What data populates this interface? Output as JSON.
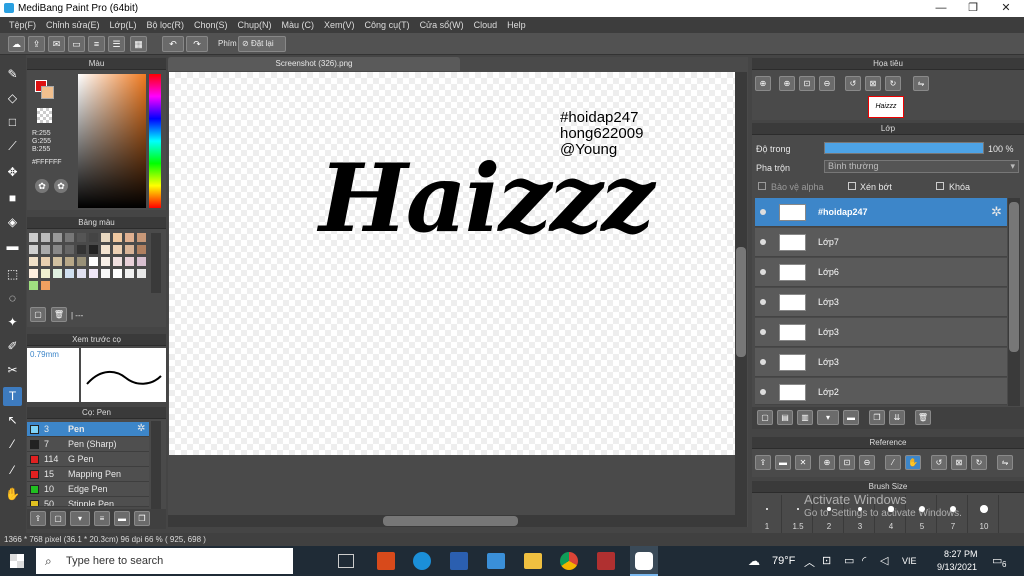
{
  "window": {
    "title": "MediBang Paint Pro (64bit)",
    "minimize": "—",
    "maximize": "❐",
    "close": "✕"
  },
  "menu": [
    "Tệp(F)",
    "Chỉnh sửa(E)",
    "Lớp(L)",
    "Bộ lọc(R)",
    "Chọn(S)",
    "Chụp(N)",
    "Màu (C)",
    "Xem(V)",
    "Công cụ(T)",
    "Cửa sổ(W)",
    "Cloud",
    "Help"
  ],
  "toolbar": {
    "phim_label": "Phím",
    "reset_label": "Đặt lại"
  },
  "color_panel": {
    "title": "Màu",
    "r": "R:255",
    "g": "G:255",
    "b": "B:255",
    "hex": "#FFFFFF"
  },
  "palette_panel": {
    "title": "Bảng màu",
    "dash": "| ---"
  },
  "brush_preview": {
    "title": "Xem trước cọ",
    "size": "0.79mm"
  },
  "brush_panel": {
    "title": "Cọ: Pen",
    "brushes": [
      {
        "num": "3",
        "name": "Pen",
        "color": "#7fd3f7"
      },
      {
        "num": "7",
        "name": "Pen (Sharp)",
        "color": "#222222"
      },
      {
        "num": "114",
        "name": "G Pen",
        "color": "#e02020"
      },
      {
        "num": "15",
        "name": "Mapping Pen",
        "color": "#e02020"
      },
      {
        "num": "10",
        "name": "Edge Pen",
        "color": "#20c020"
      },
      {
        "num": "50",
        "name": "Stipple Pen",
        "color": "#e0c020"
      }
    ]
  },
  "canvas": {
    "tab": "Screenshot (326).png",
    "text_lines": [
      "#hoidap247",
      "hong622009",
      "@Young"
    ],
    "big_text": "Haizzz"
  },
  "navigator": {
    "title": "Họa tiêu",
    "thumb_text": "Haizzz"
  },
  "layer_panel": {
    "title": "Lớp",
    "opacity_label": "Độ trong",
    "opacity_value": "100 %",
    "opacity_fraction": 1.0,
    "blend_label": "Pha trộn",
    "blend_value": "Bình thường",
    "protect_alpha": "Bảo vệ alpha",
    "clipping": "Xén bớt",
    "lock": "Khóa",
    "layers": [
      {
        "name": "#hoidap247",
        "selected": true
      },
      {
        "name": "Lớp7",
        "selected": false
      },
      {
        "name": "Lớp6",
        "selected": false
      },
      {
        "name": "Lớp3",
        "selected": false
      },
      {
        "name": "Lớp3",
        "selected": false
      },
      {
        "name": "Lớp3",
        "selected": false
      },
      {
        "name": "Lớp2",
        "selected": false
      }
    ]
  },
  "reference_panel": {
    "title": "Reference"
  },
  "brush_size_panel": {
    "title": "Brush Size",
    "sizes": [
      "1",
      "1.5",
      "2",
      "3",
      "4",
      "5",
      "7",
      "10"
    ]
  },
  "activation": {
    "line1": "Activate Windows",
    "line2": "Go to Settings to activate Windows."
  },
  "status": {
    "text": "1366 * 768 pixel   (36.1 * 20.3cm)   96 dpi   66 %   ( 925, 698 )"
  },
  "taskbar": {
    "search_placeholder": "Type here to search",
    "weather": "79°F",
    "lang": "VIE",
    "time": "8:27 PM",
    "date": "9/13/2021",
    "notif_count": "6"
  }
}
